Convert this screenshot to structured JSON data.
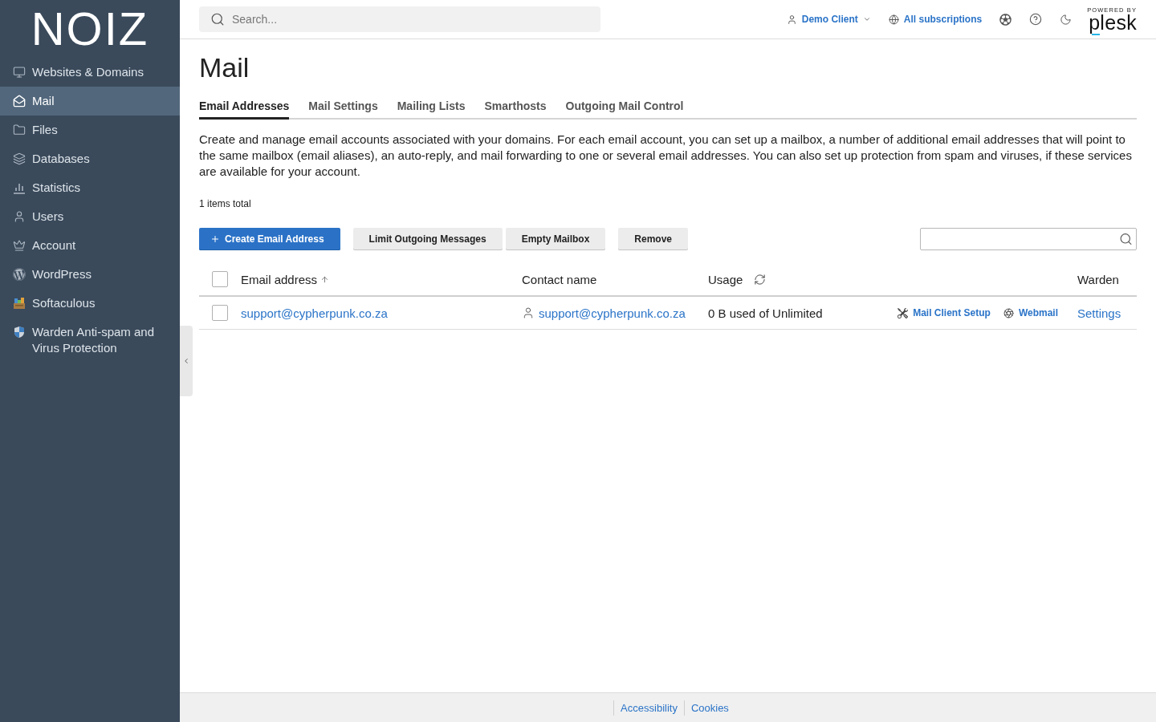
{
  "sidebar": {
    "logo": "NOIZ",
    "items": [
      {
        "label": "Websites & Domains",
        "selected": false
      },
      {
        "label": "Mail",
        "selected": true
      },
      {
        "label": "Files",
        "selected": false
      },
      {
        "label": "Databases",
        "selected": false
      },
      {
        "label": "Statistics",
        "selected": false
      },
      {
        "label": "Users",
        "selected": false
      },
      {
        "label": "Account",
        "selected": false
      },
      {
        "label": "WordPress",
        "selected": false
      },
      {
        "label": "Softaculous",
        "selected": false
      },
      {
        "label": "Warden Anti-spam and Virus Protection",
        "selected": false
      }
    ]
  },
  "topbar": {
    "search": {
      "placeholder": "Search..."
    },
    "user": "Demo Client",
    "subscriptions": "All subscriptions",
    "brand": {
      "tagline": "POWERED BY",
      "name": "plesk"
    }
  },
  "page": {
    "title": "Mail",
    "tabs": [
      {
        "label": "Email Addresses",
        "selected": true
      },
      {
        "label": "Mail Settings",
        "selected": false
      },
      {
        "label": "Mailing Lists",
        "selected": false
      },
      {
        "label": "Smarthosts",
        "selected": false
      },
      {
        "label": "Outgoing Mail Control",
        "selected": false
      }
    ],
    "description": "Create and manage email accounts associated with your domains. For each email account, you can set up a mailbox, a number of additional email addresses that will point to the same mailbox (email aliases), an auto-reply, and mail forwarding to one or several email addresses. You can also set up protection from spam and viruses, if these services are available for your account.",
    "total": "1 items total"
  },
  "toolbar": {
    "groups": [
      [
        {
          "label": "Create Email Address",
          "kind": "primary"
        }
      ],
      [
        {
          "label": "Limit Outgoing Messages",
          "kind": "default"
        },
        {
          "label": "Empty Mailbox",
          "kind": "default"
        }
      ],
      [
        {
          "label": "Remove",
          "kind": "default"
        }
      ]
    ]
  },
  "table": {
    "select_all": {
      "checked": false
    },
    "columns": [
      {
        "label": "Email address",
        "sorted": true
      },
      {
        "label": "Contact name",
        "sorted": false
      },
      {
        "label": "Usage",
        "sorted": false
      },
      {
        "label": "Warden",
        "sorted": false
      }
    ],
    "rows": [
      {
        "checked": false,
        "email": "support@cypherpunk.co.za",
        "contact": "support@cypherpunk.co.za",
        "usage": "0 B used of Unlimited",
        "actions": [
          "Mail Client Setup",
          "Webmail"
        ],
        "warden": "Settings"
      }
    ]
  },
  "footer": {
    "links": [
      "Accessibility",
      "Cookies"
    ]
  }
}
